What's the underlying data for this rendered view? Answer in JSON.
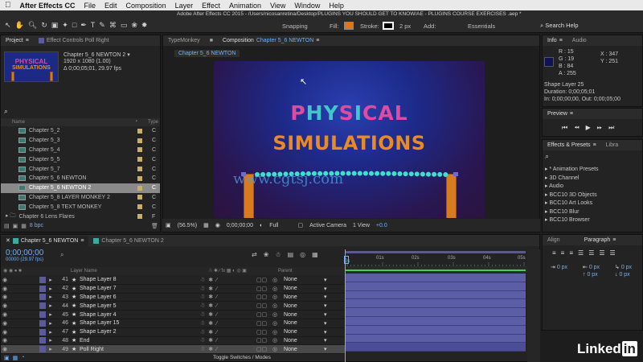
{
  "menubar": {
    "app": "After Effects CC",
    "items": [
      "File",
      "Edit",
      "Composition",
      "Layer",
      "Effect",
      "Animation",
      "View",
      "Window",
      "Help"
    ]
  },
  "window_title": "Adobe After Effects CC 2015 - /Users/nicosanretina/Desktop/PLUGINS YOU SHOULD GET  TO KNOW/AE - PLUGINS COURSE EXERCISES .aep *",
  "toolbar": {
    "snapping": "Snapping",
    "fill": "Fill:",
    "stroke": "Stroke:",
    "stroke_width": "2 px",
    "add": "Add:",
    "workspace": "Essentials",
    "search": "Search Help",
    "fill_color": "#d9791a"
  },
  "project": {
    "tab_project": "Project",
    "tab_effects": "Effect Controls Poll Right",
    "comp_name": "Chapter 5_6 NEWTON 2",
    "comp_size": "1920 x 1080 (1.00)",
    "comp_duration": "Δ 0;00;05;01, 29.97 fps",
    "thumb_line1": "PHYSICAL",
    "thumb_line2": "SIMULATIONS",
    "col_name": "Name",
    "col_type": "Type",
    "items": [
      {
        "name": "Chapter 5_2",
        "type": "C"
      },
      {
        "name": "Chapter 5_3",
        "type": "C"
      },
      {
        "name": "Chapter 5_4",
        "type": "C"
      },
      {
        "name": "Chapter 5_5",
        "type": "C"
      },
      {
        "name": "Chapter 5_7",
        "type": "C"
      },
      {
        "name": "Chapter 5_6 NEWTON",
        "type": "C"
      },
      {
        "name": "Chapter 5_6 NEWTON 2",
        "type": "C"
      },
      {
        "name": "Chapter 5_8 LAYER MONKEY 2",
        "type": "C"
      },
      {
        "name": "Chapter 5_8 TEXT MONKEY",
        "type": "C"
      },
      {
        "name": "Chapter 6 Lens Flares",
        "type": "F"
      }
    ],
    "bpc": "8 bpc"
  },
  "composition": {
    "tab_typemonkey": "TypeMonkey",
    "tab_comp": "Composition",
    "tab_comp_name": "Chapter 5_6 NEWTON",
    "subtab": "Chapter 5_6 NEWTON",
    "title_line1_parts": [
      "P",
      "HY",
      "S",
      "I",
      "CAL"
    ],
    "title_line2": "SIMULATIONS",
    "watermark": "www.cgtsj.com",
    "footer": {
      "zoom": "(56.5%)",
      "timecode": "0;00;00;00",
      "resolution": "Full",
      "camera": "Active Camera",
      "views": "1 View",
      "offset": "+0.0"
    }
  },
  "info": {
    "tab_info": "Info",
    "tab_audio": "Audio",
    "r": "R : 15",
    "g": "G : 19",
    "b": "B : 84",
    "a": "A : 255",
    "x": "X : 347",
    "y": "Y : 251",
    "layer": "Shape Layer 25",
    "duration": "Duration: 0;00;05;01",
    "inout": "In: 0;00;00;00, Out: 0;00;05;00",
    "swatch_color": "#0f1354"
  },
  "preview": {
    "tab": "Preview"
  },
  "effects": {
    "tab": "Effects & Presets",
    "tab2": "Libra",
    "items": [
      "* Animation Presets",
      "3D Channel",
      "Audio",
      "BCC10 3D Objects",
      "BCC10 Art Looks",
      "BCC10 Blur",
      "BCC10 Browser"
    ]
  },
  "align": {
    "tab_align": "Align",
    "tab_paragraph": "Paragraph",
    "vals": [
      "0 px",
      "0 px",
      "0 px",
      "0 px",
      "0 px"
    ]
  },
  "timeline": {
    "tab1": "Chapter 5_6 NEWTON",
    "tab2": "Chapter 5_6 NEWTON 2",
    "timecode": "0;00;00;00",
    "fps": "00000 (29.97 fps)",
    "col_layer": "Layer Name",
    "col_parent": "Parent",
    "ruler": [
      "0s",
      "01s",
      "02s",
      "03s",
      "04s",
      "05s"
    ],
    "layers": [
      {
        "num": "41",
        "name": "Shape Layer 8",
        "parent": "None"
      },
      {
        "num": "42",
        "name": "Shape Layer 7",
        "parent": "None"
      },
      {
        "num": "43",
        "name": "Shape Layer 6",
        "parent": "None"
      },
      {
        "num": "44",
        "name": "Shape Layer 5",
        "parent": "None"
      },
      {
        "num": "45",
        "name": "Shape Layer 4",
        "parent": "None"
      },
      {
        "num": "46",
        "name": "Shape Layer 15",
        "parent": "None"
      },
      {
        "num": "47",
        "name": "Shape Layer 2",
        "parent": "None"
      },
      {
        "num": "48",
        "name": "End",
        "parent": "None"
      },
      {
        "num": "49",
        "name": "Poll Right",
        "parent": "None"
      }
    ],
    "toggle": "Toggle Switches / Modes"
  },
  "brand": {
    "name": "Linked",
    "in": "in"
  }
}
